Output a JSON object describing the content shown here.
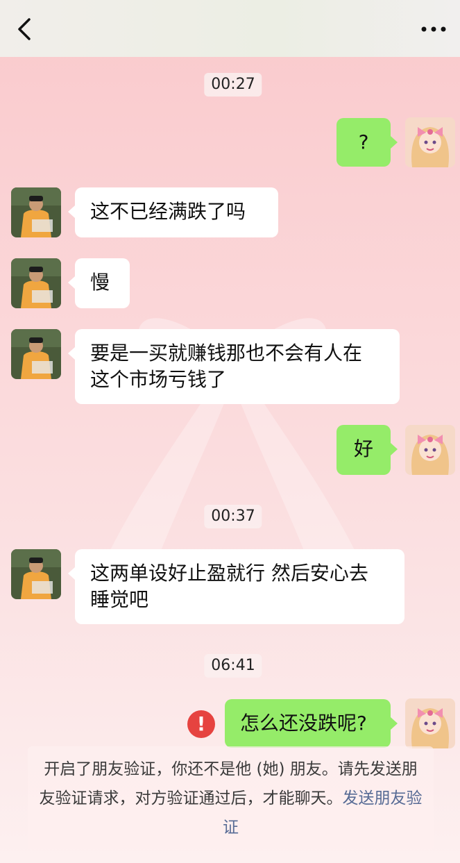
{
  "header": {
    "back_icon": "chevron-left-icon",
    "more_icon": "more-dots-icon"
  },
  "messages": {
    "ts1": "00:27",
    "m1": "?",
    "m2": "这不已经满跌了吗",
    "m3": "慢",
    "m4_line1": "要是一买就赚钱那也不会有人在",
    "m4_line2": "这个市场亏钱了",
    "m5": "好",
    "ts2": "00:37",
    "m6_line1": "这两单设好止盈就行 然后安心去",
    "m6_line2": "睡觉吧",
    "ts3": "06:41",
    "m7": "怎么还没跌呢?",
    "error_mark": "!"
  },
  "notice": {
    "text": "开启了朋友验证，你还不是他 (她) 朋友。请先发送朋友验证请求，对方验证通过后，才能聊天。",
    "link": "发送朋友验证"
  },
  "colors": {
    "outgoing_bubble": "#95ec69",
    "incoming_bubble": "#ffffff",
    "error": "#e64340",
    "link": "#576b95"
  }
}
